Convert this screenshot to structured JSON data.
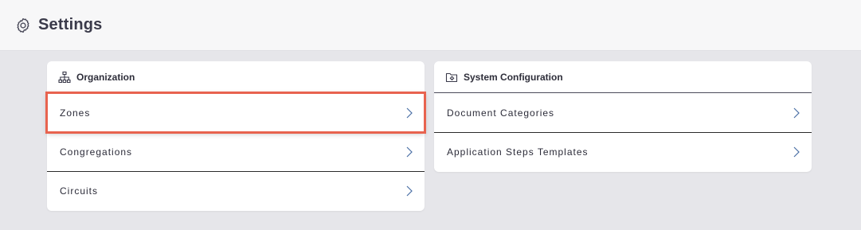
{
  "header": {
    "title": "Settings",
    "icon": "gear-icon"
  },
  "organization": {
    "title": "Organization",
    "icon": "org-chart-icon",
    "items": [
      {
        "label": "Zones"
      },
      {
        "label": "Congregations"
      },
      {
        "label": "Circuits"
      }
    ]
  },
  "system_configuration": {
    "title": "System Configuration",
    "icon": "folder-settings-icon",
    "items": [
      {
        "label": "Document Categories"
      },
      {
        "label": "Application Steps Templates"
      }
    ]
  },
  "colors": {
    "highlight": "#e8634f",
    "chevron": "#4a6fa5",
    "page_bg": "#e6e6ea"
  }
}
